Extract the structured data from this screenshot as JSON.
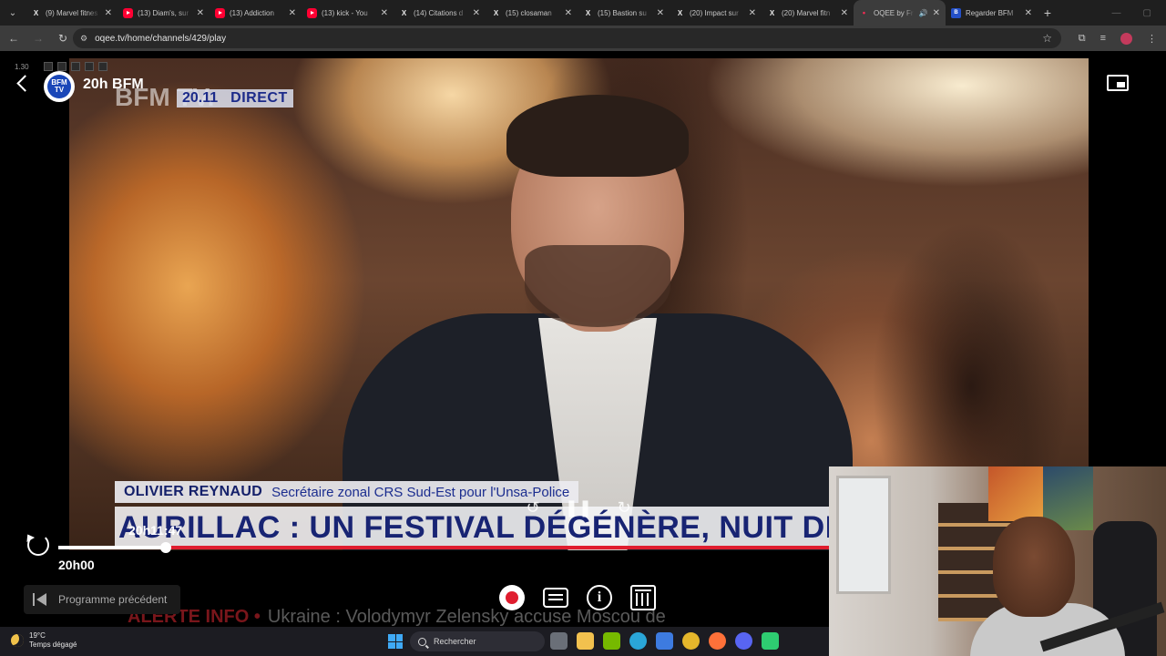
{
  "browser": {
    "tabs": [
      {
        "icon": "x-icon",
        "title": "(9) Marvel fitnes",
        "active": false
      },
      {
        "icon": "youtube-icon",
        "title": "(13) Diam's, sur",
        "active": false
      },
      {
        "icon": "youtube-icon",
        "title": "(13) Addiction",
        "active": false
      },
      {
        "icon": "youtube-icon",
        "title": "(13) kick - You",
        "active": false
      },
      {
        "icon": "x-icon",
        "title": "(14) Citations d",
        "active": false
      },
      {
        "icon": "x-icon",
        "title": "(15) closaman",
        "active": false
      },
      {
        "icon": "x-icon",
        "title": "(15) Bastion su",
        "active": false
      },
      {
        "icon": "x-icon",
        "title": "(20) Impact sur",
        "active": false
      },
      {
        "icon": "x-icon",
        "title": "(20) Marvel fitn",
        "active": false
      },
      {
        "icon": "oqee-icon",
        "title": "OQEE by Fr",
        "active": true
      },
      {
        "icon": "bfm-icon",
        "title": "Regarder BFM",
        "active": false
      }
    ],
    "url": "oqee.tv/home/channels/429/play"
  },
  "player": {
    "version": "1.30",
    "channel_logo_text": "BFM TV",
    "channel_title": "20h BFM",
    "current_time": "20h11:47",
    "start_time": "20h00",
    "progress_fraction": 0.14,
    "prev_program_label": "Programme précédent"
  },
  "broadcast": {
    "logo": "BFM TV.",
    "clock": "20.11",
    "live": "DIRECT",
    "guest_name": "OLIVIER REYNAUD",
    "guest_role": "Secrétaire zonal CRS Sud-Est pour l'Unsa-Police",
    "headline": "AURILLAC : UN FESTIVAL DÉGÉNÈRE, NUIT DE VIOLENCES",
    "ticker_label": "ALERTE INFO •",
    "ticker_text": "Ukraine : Volodymyr Zelensky accuse Moscou de"
  },
  "taskbar": {
    "temperature": "19°C",
    "weather": "Temps dégagé",
    "search_label": "Rechercher"
  },
  "colors": {
    "progress_red": "#e01d2f",
    "bfm_blue": "#1c2b8a"
  }
}
